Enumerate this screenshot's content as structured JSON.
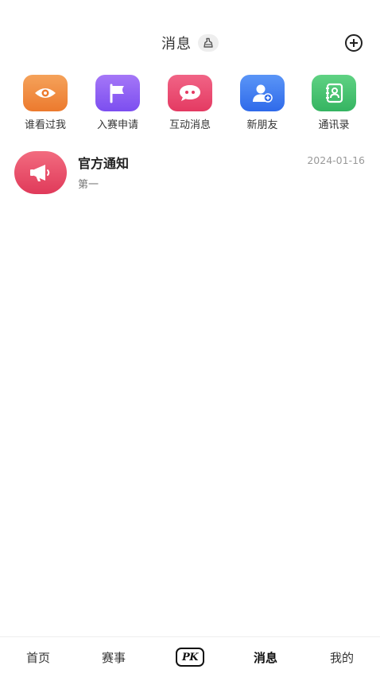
{
  "header": {
    "title": "消息",
    "clean_icon": "broom-icon",
    "add_icon": "plus-circle-icon"
  },
  "shortcuts": [
    {
      "label": "谁看过我",
      "icon": "eye-icon",
      "color": "#f0883a"
    },
    {
      "label": "入赛申请",
      "icon": "flag-icon",
      "color": "#8b5cf6"
    },
    {
      "label": "互动消息",
      "icon": "chat-bubble-icon",
      "color": "#ec4a73"
    },
    {
      "label": "新朋友",
      "icon": "user-add-icon",
      "color": "#3b7cf0"
    },
    {
      "label": "通讯录",
      "icon": "contact-book-icon",
      "color": "#3fbf6a"
    }
  ],
  "messages": [
    {
      "title": "官方通知",
      "preview": "第一",
      "time": "2024-01-16",
      "icon": "megaphone-icon"
    }
  ],
  "tabbar": {
    "items": [
      {
        "label": "首页"
      },
      {
        "label": "赛事"
      },
      {
        "label": "PK"
      },
      {
        "label": "消息"
      },
      {
        "label": "我的"
      }
    ],
    "active": "消息"
  }
}
